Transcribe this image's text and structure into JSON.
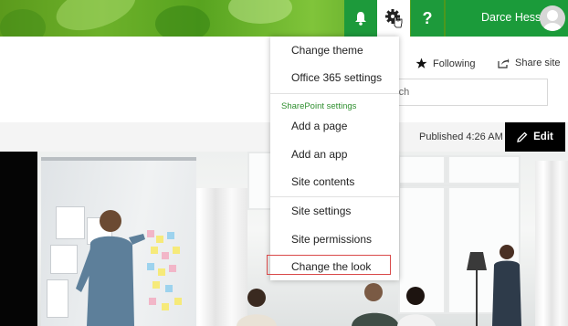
{
  "suitebar": {
    "user_name": "Darce Hess",
    "help_label": "?",
    "icons": {
      "notifications": "bell-icon",
      "settings": "gear-icon",
      "help": "question-icon",
      "avatar": "user-icon"
    },
    "colors": {
      "bar": "#1d9a3b",
      "theme_green": "#6db12a"
    }
  },
  "actions": {
    "following_label": "Following",
    "share_label": "Share site"
  },
  "search": {
    "placeholder_visible": "rch"
  },
  "command_bar": {
    "published_label": "Published 4:26 AM",
    "edit_label": "Edit"
  },
  "settings_menu": {
    "top_items": [
      "Change theme",
      "Office 365 settings"
    ],
    "section_title": "SharePoint settings",
    "section_items": [
      "Add a page",
      "Add an app",
      "Site contents"
    ],
    "bottom_items": [
      "Site settings",
      "Site permissions",
      "Change the look"
    ],
    "highlighted_item": "Change the look",
    "colors": {
      "section_title": "#2f8f2f",
      "highlight_border": "#d94a4a"
    }
  }
}
